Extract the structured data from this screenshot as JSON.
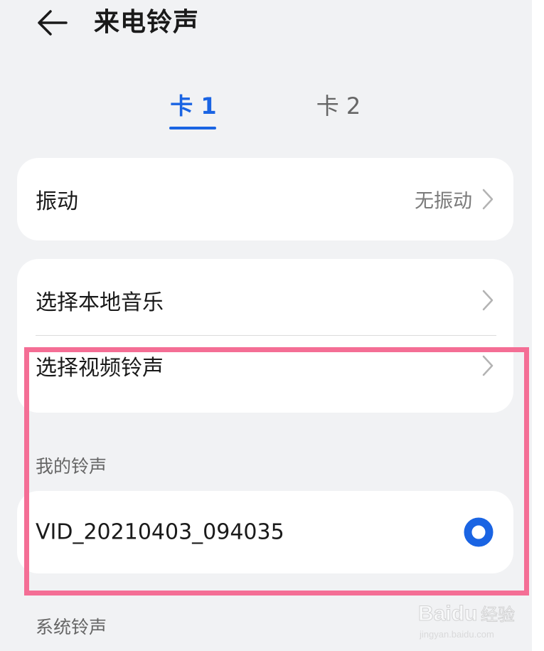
{
  "header": {
    "title": "来电铃声",
    "back_icon": "arrow-left-icon"
  },
  "tabs": [
    {
      "label": "卡 1",
      "selected": true
    },
    {
      "label": "卡 2",
      "selected": false
    }
  ],
  "vibration": {
    "label": "振动",
    "value": "无振动"
  },
  "select_options": [
    {
      "label": "选择本地音乐"
    },
    {
      "label": "选择视频铃声"
    }
  ],
  "my_ringtones": {
    "section_label": "我的铃声",
    "items": [
      {
        "name": "VID_20210403_094035",
        "selected": true
      }
    ]
  },
  "system_ringtones": {
    "section_label": "系统铃声"
  },
  "watermark": {
    "brand": "Baidu",
    "suffix": "经验",
    "url": "jingyan.baidu.com"
  },
  "colors": {
    "accent": "#1a64e3",
    "background": "#f1f2f4",
    "card": "#ffffff",
    "highlight": "#f46e95"
  }
}
